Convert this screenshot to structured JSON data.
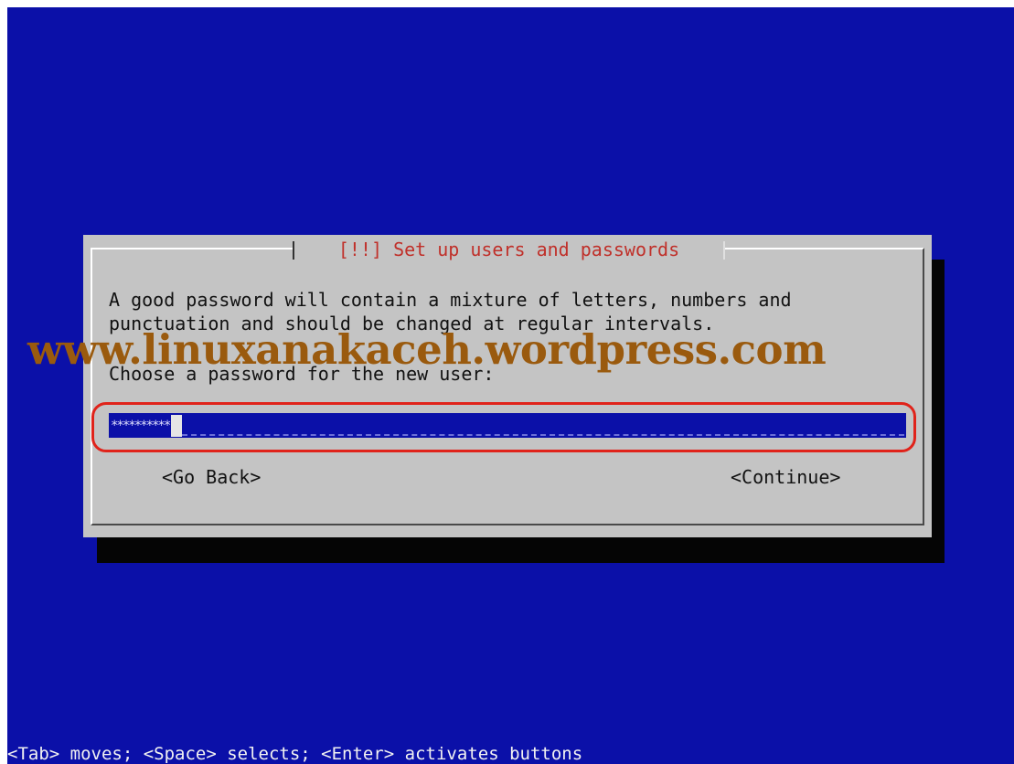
{
  "dialog": {
    "title": "[!!] Set up users and passwords",
    "lines": [
      "A good password will contain a mixture of letters, numbers and",
      "punctuation and should be changed at regular intervals.",
      "Choose a password for the new user:"
    ],
    "password_value": "**********",
    "buttons": {
      "back": "<Go Back>",
      "continue": "<Continue>"
    }
  },
  "watermark": "www.linuxanakaceh.wordpress.com",
  "footer": {
    "hint": "<Tab> moves; <Space> selects; <Enter> activates buttons"
  },
  "colors": {
    "background": "#0b10a8",
    "dialog": "#c4c4c4",
    "title": "#c0302a",
    "highlight_ring": "#e0231a",
    "watermark": "#9a5a0e"
  }
}
